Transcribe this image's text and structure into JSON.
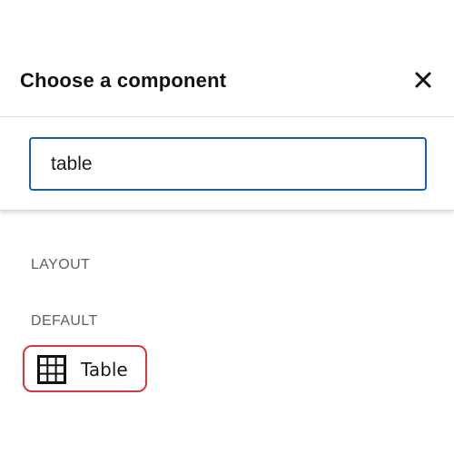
{
  "dialog": {
    "title": "Choose a component",
    "close_icon": "close-icon"
  },
  "search": {
    "value": "table",
    "border_color": "#1b5faa"
  },
  "sections": {
    "layout": "LAYOUT",
    "default": "DEFAULT"
  },
  "components": [
    {
      "label": "Table",
      "icon": "table-grid-icon",
      "selected": true,
      "highlight_color": "#d7363b"
    }
  ]
}
